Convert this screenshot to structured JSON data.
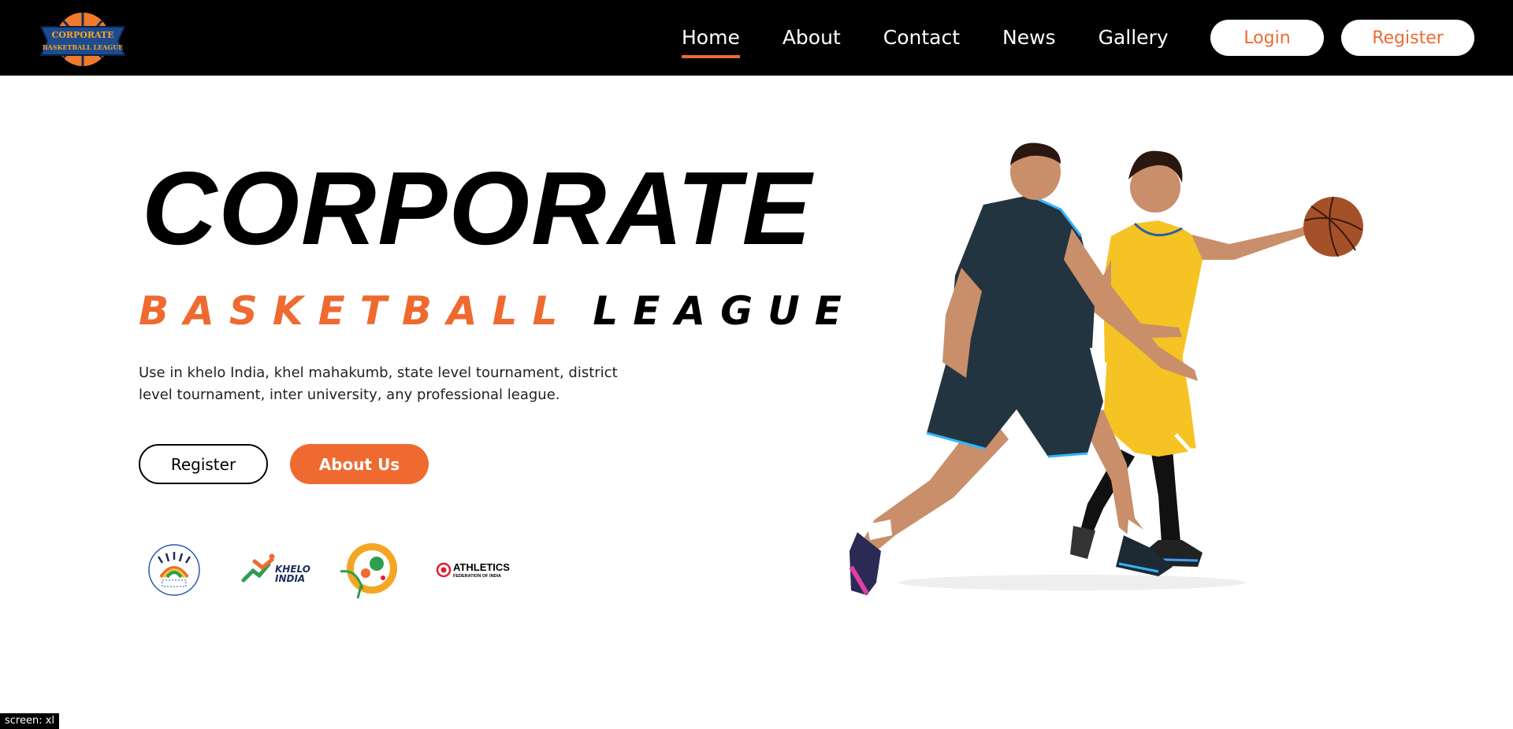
{
  "nav": {
    "logo_text_top": "CORPORATE",
    "logo_text_bottom": "BASKETBALL LEAGUE",
    "links": [
      {
        "label": "Home",
        "active": true
      },
      {
        "label": "About",
        "active": false
      },
      {
        "label": "Contact",
        "active": false
      },
      {
        "label": "News",
        "active": false
      },
      {
        "label": "Gallery",
        "active": false
      }
    ],
    "login_label": "Login",
    "register_label": "Register"
  },
  "hero": {
    "title": "CORPORATE",
    "subtitle_orange": "BASKETBALL",
    "subtitle_black": "LEAGUE",
    "description": "Use in khelo India, khel mahakumb, state level tournament, district level tournament, inter university, any professional league.",
    "register_label": "Register",
    "about_label": "About Us"
  },
  "partners": {
    "khelo_line1": "KHELO",
    "khelo_line2": "INDIA",
    "athletics_line1": "ATHLETICS",
    "athletics_line2": "FEDERATION OF INDIA"
  },
  "footer_tag": "screen: xl",
  "colors": {
    "accent": "#ee6a30",
    "navbar": "#000000",
    "background": "#ffffff"
  }
}
